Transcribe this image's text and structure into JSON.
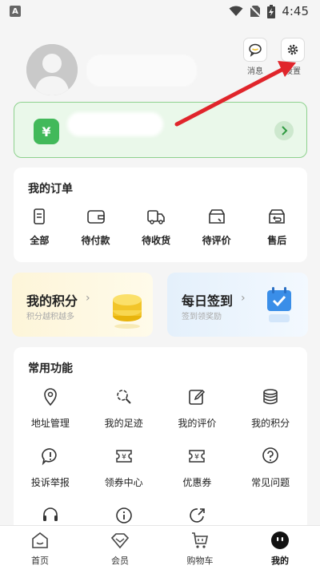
{
  "status_bar": {
    "notification_icon": "a-badge-icon",
    "time": "4:45"
  },
  "header": {
    "messages_label": "消息",
    "settings_label": "设置",
    "avatar_icon": "default-avatar-icon"
  },
  "wallet": {
    "icon_symbol": "¥"
  },
  "orders": {
    "title": "我的订单",
    "items": [
      {
        "label": "全部",
        "icon": "list-icon"
      },
      {
        "label": "待付款",
        "icon": "wallet-icon"
      },
      {
        "label": "待收货",
        "icon": "delivery-icon"
      },
      {
        "label": "待评价",
        "icon": "review-icon"
      },
      {
        "label": "售后",
        "icon": "return-icon"
      }
    ]
  },
  "promos": {
    "points": {
      "title": "我的积分",
      "subtitle": "积分越积越多"
    },
    "signin": {
      "title": "每日签到",
      "subtitle": "签到领奖励"
    }
  },
  "functions": {
    "title": "常用功能",
    "items": [
      {
        "label": "地址管理",
        "icon": "location-icon"
      },
      {
        "label": "我的足迹",
        "icon": "footprint-icon"
      },
      {
        "label": "我的评价",
        "icon": "edit-icon"
      },
      {
        "label": "我的积分",
        "icon": "coins-icon"
      },
      {
        "label": "投诉举报",
        "icon": "complaint-icon"
      },
      {
        "label": "领券中心",
        "icon": "coupon-center-icon"
      },
      {
        "label": "优惠券",
        "icon": "coupon-icon"
      },
      {
        "label": "常见问题",
        "icon": "question-icon"
      },
      {
        "label": "",
        "icon": "headset-icon"
      },
      {
        "label": "",
        "icon": "info-icon"
      },
      {
        "label": "",
        "icon": "share-icon"
      }
    ]
  },
  "tabbar": {
    "items": [
      {
        "label": "首页",
        "icon": "home-icon"
      },
      {
        "label": "会员",
        "icon": "diamond-icon"
      },
      {
        "label": "购物车",
        "icon": "cart-icon"
      },
      {
        "label": "我的",
        "icon": "profile-face-icon",
        "active": true
      }
    ]
  },
  "colors": {
    "accent_green": "#42b95a",
    "wallet_bg": "#eaf8ea",
    "annotation_red": "#e0252b",
    "page_bg": "#f5f5f5"
  }
}
